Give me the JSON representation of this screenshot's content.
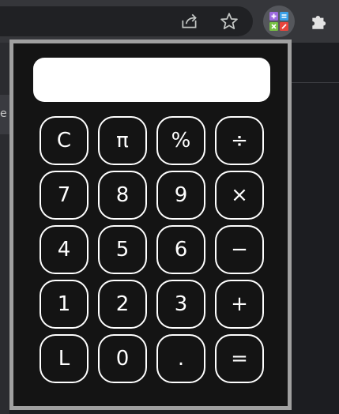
{
  "toolbar": {
    "icons": {
      "share": "share-icon",
      "star": "star-icon",
      "extension": "calculator-extension-icon",
      "extensions_menu": "puzzle-icon"
    }
  },
  "sidebar": {
    "tab_letter": "e"
  },
  "calculator": {
    "display_value": "",
    "keys": [
      [
        "C",
        "π",
        "%",
        "÷"
      ],
      [
        "7",
        "8",
        "9",
        "×"
      ],
      [
        "4",
        "5",
        "6",
        "−"
      ],
      [
        "1",
        "2",
        "3",
        "+"
      ],
      [
        "L",
        "0",
        ".",
        "="
      ]
    ]
  },
  "colors": {
    "popup_background": "#141414",
    "popup_border": "#a0a0a0",
    "key_border": "#ffffff",
    "display_background": "#ffffff",
    "extension_icon_plus": "#9c6ade",
    "extension_icon_minus": "#3aa0e8",
    "extension_icon_times": "#76c043",
    "extension_icon_divide": "#e8453c"
  }
}
